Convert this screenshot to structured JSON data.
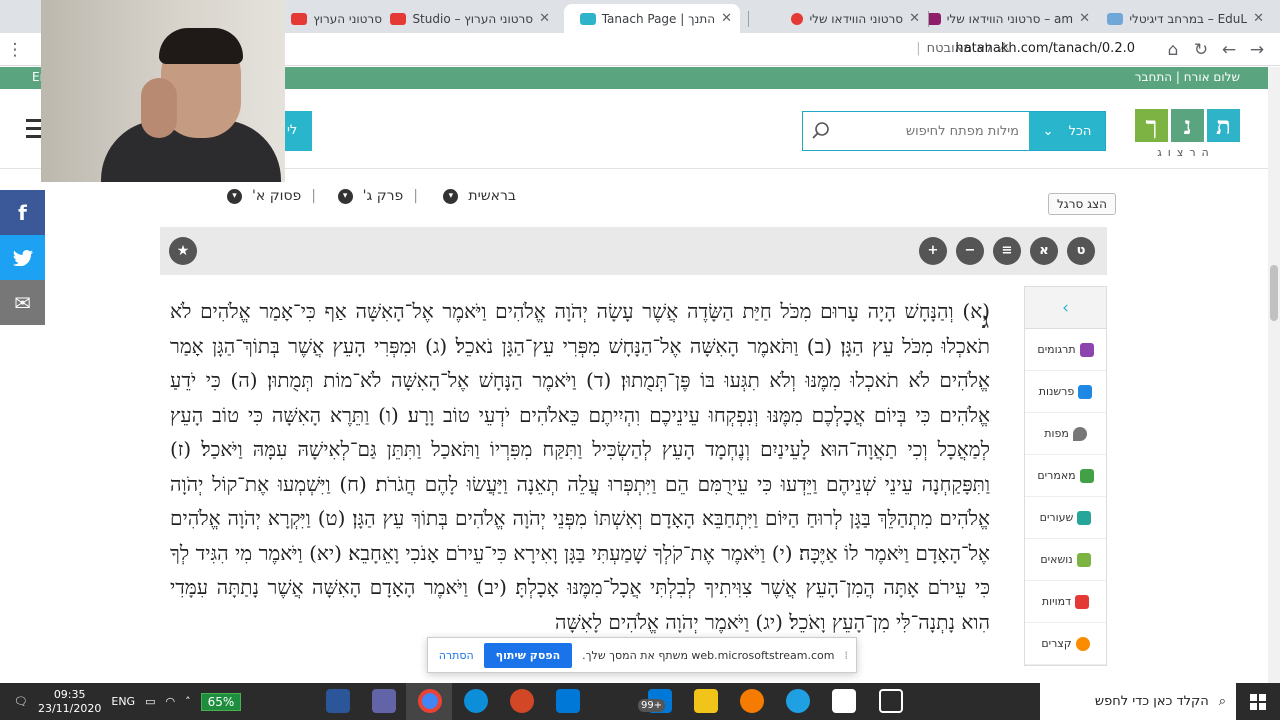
{
  "browser": {
    "tabs": [
      {
        "title": "EduL – במרחב דיגיטלי",
        "icon_color": "#6fa7d8",
        "active": false
      },
      {
        "title": "am – סרטוני הווידאו שלי",
        "icon_color": "#8e1e6a",
        "active": false
      },
      {
        "title": "סרטוני הווידאו שלי",
        "icon_color": "#e53935",
        "active": false
      },
      {
        "title": "התנך | Tanach Page",
        "icon_color": "#2fb3c9",
        "active": true
      },
      {
        "title": "סרטוני הערוץ – Studio",
        "icon_color": "#e53935",
        "active": false
      },
      {
        "title": "סרטוני הערוץ",
        "icon_color": "#e53935",
        "active": false
      }
    ],
    "url": "hatanakh.com/tanach/0.2.0",
    "security_label": "לא מאובטח"
  },
  "site": {
    "greeting": "שלום אורח | התחבר",
    "green_strip_left": "Er",
    "logo_letters": [
      "ת",
      "נ",
      "ך"
    ],
    "logo_colors": [
      "#2fb3c9",
      "#5aa57f",
      "#7cb342"
    ],
    "logo_sub": "הרצוג",
    "search_scope": "הכל",
    "search_placeholder": "מילות מפתח לחיפוש",
    "login_label": "לי",
    "brand_accent": "#29b6cc"
  },
  "social": [
    {
      "name": "facebook",
      "glyph": "f",
      "color": "#3b5998"
    },
    {
      "name": "twitter",
      "glyph": "t",
      "color": "#1da1f2"
    },
    {
      "name": "email",
      "glyph": "✉",
      "color": "#777777"
    }
  ],
  "navigation": {
    "book": "בראשית",
    "chapter": "פרק ג'",
    "verse": "פסוק א'",
    "flat_view_label": "הצג סרגל"
  },
  "reader_tools": {
    "tools": [
      "ט",
      "א",
      "≡",
      "−",
      "+"
    ],
    "favorite_icon": "★"
  },
  "text": {
    "chapter_letter": "ג",
    "body": "(א) וְהַנָּחָשׁ הָיָה עָרוּם מִכֹּל חַיַּת הַשָּׂדֶה אֲשֶׁר עָשָׂה יְהֹוָה אֱלֹהִים וַיֹּאמֶר אֶל־הָאִשָּׁה אַף כִּי־אָמַר אֱלֹהִים לֹא תֹאכְלוּ מִכֹּל עֵץ הַגָּן׃ (ב) וַתֹּאמֶר הָאִשָּׁה אֶל־הַנָּחָשׁ מִפְּרִי עֵץ־הַגָּן נֹאכֵל׃ (ג) וּמִפְּרִי הָעֵץ אֲשֶׁר בְּתוֹךְ־הַגָּן אָמַר אֱלֹהִים לֹא תֹאכְלוּ מִמֶּנּוּ וְלֹא תִגְּעוּ בּוֹ פֶּן־תְּמֻתוּן׃ (ד) וַיֹּאמֶר הַנָּחָשׁ אֶל־הָאִשָּׁה לֹא־מוֹת תְּמֻתוּן׃ (ה) כִּי יֹדֵעַ אֱלֹהִים כִּי בְּיוֹם אֲכָלְכֶם מִמֶּנּוּ וְנִפְקְחוּ עֵינֵיכֶם וִהְיִיתֶם כֵּאלֹהִים יֹדְעֵי טוֹב וָרָע׃ (ו) וַתֵּרֶא הָאִשָּׁה כִּי טוֹב הָעֵץ לְמַאֲכָל וְכִי תַאֲוָה־הוּא לָעֵינַיִם וְנֶחְמָד הָעֵץ לְהַשְׂכִּיל וַתִּקַּח מִפִּרְיוֹ וַתֹּאכַל וַתִּתֵּן גַּם־לְאִישָׁהּ עִמָּהּ וַיֹּאכַל׃ (ז) וַתִּפָּקַחְנָה עֵינֵי שְׁנֵיהֶם וַיֵּדְעוּ כִּי עֵירֻמִּם הֵם וַיִּתְפְּרוּ עֲלֵה תְאֵנָה וַיַּעֲשׂוּ לָהֶם חֲגֹרֹת׃ (ח) וַיִּשְׁמְעוּ אֶת־קוֹל יְהֹוָה אֱלֹהִים מִתְהַלֵּךְ בַּגָּן לְרוּחַ הַיּוֹם וַיִּתְחַבֵּא הָאָדָם וְאִשְׁתּוֹ מִפְּנֵי יְהֹוָה אֱלֹהִים בְּתוֹךְ עֵץ הַגָּן׃ (ט) וַיִּקְרָא יְהֹוָה אֱלֹהִים אֶל־הָאָדָם וַיֹּאמֶר לוֹ אַיֶּכָּה׃ (י) וַיֹּאמֶר אֶת־קֹלְךָ שָׁמַעְתִּי בַּגָּן וָאִירָא כִּי־עֵירֹם אָנֹכִי וָאֵחָבֵא׃ (יא) וַיֹּאמֶר מִי הִגִּיד לְךָ כִּי עֵירֹם אָתָּה הֲמִן־הָעֵץ אֲשֶׁר צִוִּיתִיךָ לְבִלְתִּי אֲכָל־מִמֶּנּוּ אָכָלְתָּ׃ (יב) וַיֹּאמֶר הָאָדָם הָאִשָּׁה אֲשֶׁר נָתַתָּה עִמָּדִי הִוא נָתְנָה־לִּי מִן־הָעֵץ וָאֹכֵל׃ (יג) וַיֹּאמֶר יְהֹוָה אֱלֹהִים לָאִשָּׁה"
  },
  "side_panel": [
    {
      "label": "תרגומים",
      "icon": "translations-icon",
      "color": "#8e44ad"
    },
    {
      "label": "פרשנות",
      "icon": "book-icon",
      "color": "#1e88e5"
    },
    {
      "label": "מפות",
      "icon": "map-pin-icon",
      "color": "#777777"
    },
    {
      "label": "מאמרים",
      "icon": "article-icon",
      "color": "#43a047"
    },
    {
      "label": "שעורים",
      "icon": "lesson-icon",
      "color": "#26a69a"
    },
    {
      "label": "נושאים",
      "icon": "folder-icon",
      "color": "#7cb342"
    },
    {
      "label": "דמויות",
      "icon": "people-icon",
      "color": "#e53935"
    },
    {
      "label": "קצרים",
      "icon": "shorts-icon",
      "color": "#fb8c00"
    }
  ],
  "share_banner": {
    "message": "web.microsoftstream.com משתף את המסך שלך.",
    "stop_label": "הפסק שיתוף",
    "hide_label": "הסתרה"
  },
  "taskbar": {
    "search_placeholder": "הקלד כאן כדי לחפש",
    "time": "09:35",
    "date": "23/11/2020",
    "language": "ENG",
    "battery": "65%",
    "apps": [
      {
        "name": "word-icon",
        "color": "#2b579a"
      },
      {
        "name": "teams-icon",
        "color": "#6264a7"
      },
      {
        "name": "chrome-icon",
        "color": "#4285f4"
      },
      {
        "name": "edge-icon",
        "color": "#0c8ed9"
      },
      {
        "name": "powerpoint-icon",
        "color": "#d24726"
      },
      {
        "name": "monitor-icon",
        "color": "#0078d7"
      },
      {
        "name": "mail-icon",
        "color": "#0078d7"
      },
      {
        "name": "folder-icon",
        "color": "#f0c419"
      },
      {
        "name": "gear-icon",
        "color": "#f57c00"
      },
      {
        "name": "ie-icon",
        "color": "#1ea0e2"
      },
      {
        "name": "store-icon",
        "color": "#ffffff"
      },
      {
        "name": "task-view-icon",
        "color": "#ffffff"
      }
    ],
    "mail_badge": "99+"
  }
}
